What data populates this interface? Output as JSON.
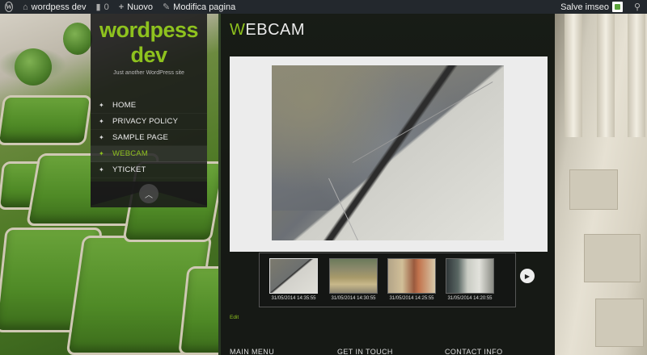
{
  "adminbar": {
    "site_name": "wordpess dev",
    "comments_count": "0",
    "new_label": "Nuovo",
    "edit_label": "Modifica pagina",
    "greeting": "Salve imseo"
  },
  "site": {
    "title": "wordpess dev",
    "tagline": "Just another WordPress site",
    "accent_color": "#8ec21e"
  },
  "menu": {
    "items": [
      {
        "label": "HOME"
      },
      {
        "label": "PRIVACY POLICY"
      },
      {
        "label": "SAMPLE PAGE"
      },
      {
        "label": "WEBCAM",
        "active": true
      },
      {
        "label": "YTICKET"
      }
    ]
  },
  "page": {
    "title_first": "W",
    "title_rest": "EBCAM",
    "edit_label": "Edit"
  },
  "gallery": {
    "thumbnails": [
      {
        "caption": "31/05/2014 14:35:55"
      },
      {
        "caption": "31/05/2014 14:30:55"
      },
      {
        "caption": "31/05/2014 14:25:55"
      },
      {
        "caption": "31/05/2014 14:20:55"
      }
    ]
  },
  "footer": {
    "columns": [
      "MAIN MENU",
      "GET IN TOUCH",
      "CONTACT INFO"
    ]
  },
  "icons": {
    "wp": "wordpress-icon",
    "comment": "comment-icon",
    "plus": "plus-icon",
    "pencil": "pencil-icon",
    "search": "search-icon",
    "next": "play-next-icon",
    "up": "chevron-up-icon"
  }
}
